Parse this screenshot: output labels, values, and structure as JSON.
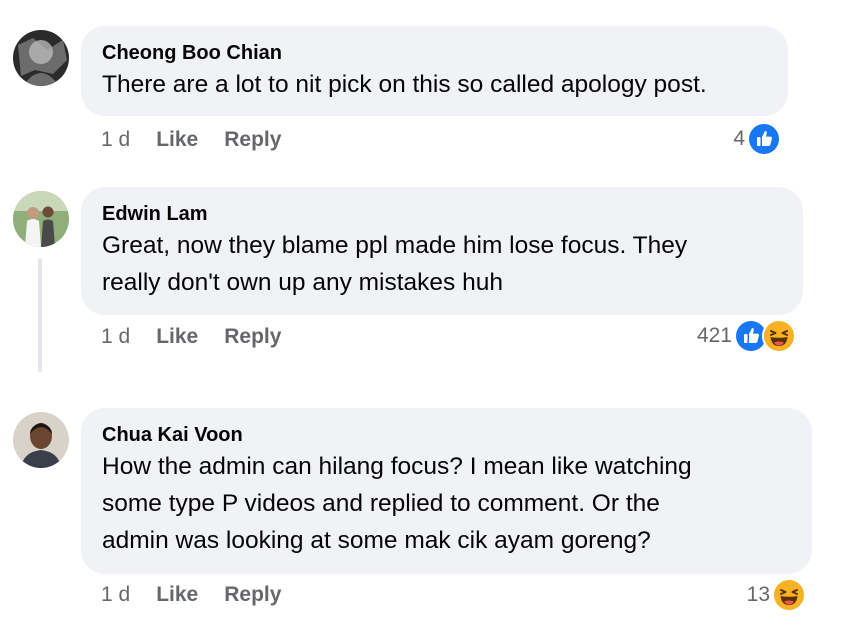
{
  "comments": [
    {
      "author": "Cheong Boo Chian",
      "text": "There are a lot to nit pick on this so called apology post.",
      "time": "1 d",
      "like_label": "Like",
      "reply_label": "Reply",
      "reaction_count": "4",
      "reactions": [
        "like-icon"
      ]
    },
    {
      "author": "Edwin Lam",
      "text": "Great, now they blame ppl made him lose focus. They\nreally don't own up any mistakes huh",
      "time": "1 d",
      "like_label": "Like",
      "reply_label": "Reply",
      "reaction_count": "421",
      "reactions": [
        "like-icon",
        "haha-icon"
      ]
    },
    {
      "author": "Chua Kai Voon",
      "text": "How the admin can hilang focus? I mean like watching\nsome type P videos and replied to comment. Or the\nadmin was looking at some mak cik ayam goreng?",
      "time": "1 d",
      "like_label": "Like",
      "reply_label": "Reply",
      "reaction_count": "13",
      "reactions": [
        "haha-icon"
      ]
    }
  ],
  "colors": {
    "bubble": "#f0f2f5",
    "action_text": "#65676b",
    "like_blue": "#1877f2",
    "haha_yellow": "#f7b125"
  }
}
